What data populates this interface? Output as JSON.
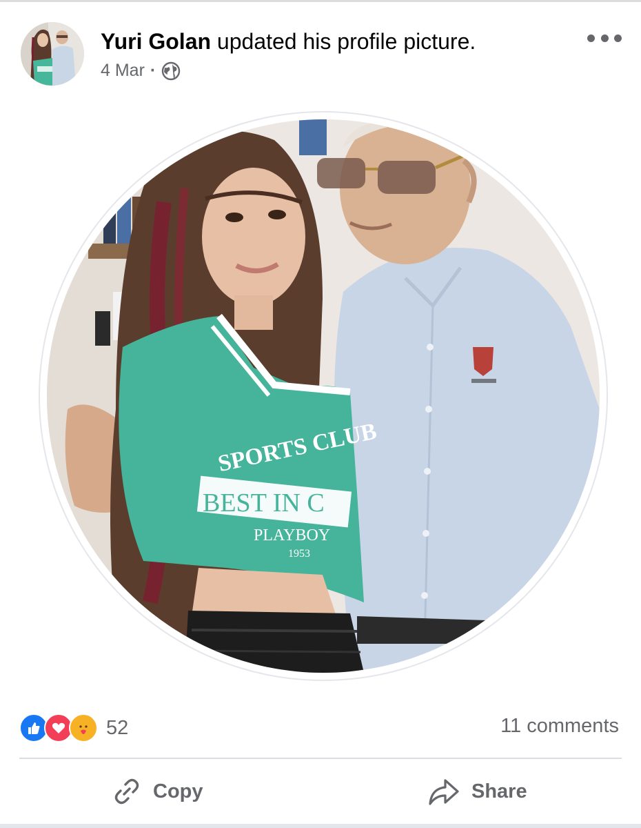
{
  "post": {
    "author": "Yuri Golan",
    "action": "updated his profile picture.",
    "date": "4 Mar",
    "separator": "·",
    "audience_icon": "globe-icon",
    "menu_icon": "more-options-icon"
  },
  "photo": {
    "description_icon": "profile-photo",
    "shirt_text_line1": "SPORTS CLUB",
    "shirt_text_line2": "BEST IN C",
    "shirt_text_line3": "PLAYBOY",
    "shirt_text_line4": "1953"
  },
  "engagement": {
    "reaction_icons": [
      "like-icon",
      "love-icon",
      "care-icon"
    ],
    "reaction_count": "52",
    "comments": "11 comments"
  },
  "actions": {
    "copy_label": "Copy",
    "share_label": "Share"
  },
  "colors": {
    "like": "#1877f2",
    "love": "#f33e58",
    "care": "#f7b125",
    "secondary_text": "#65676b"
  }
}
